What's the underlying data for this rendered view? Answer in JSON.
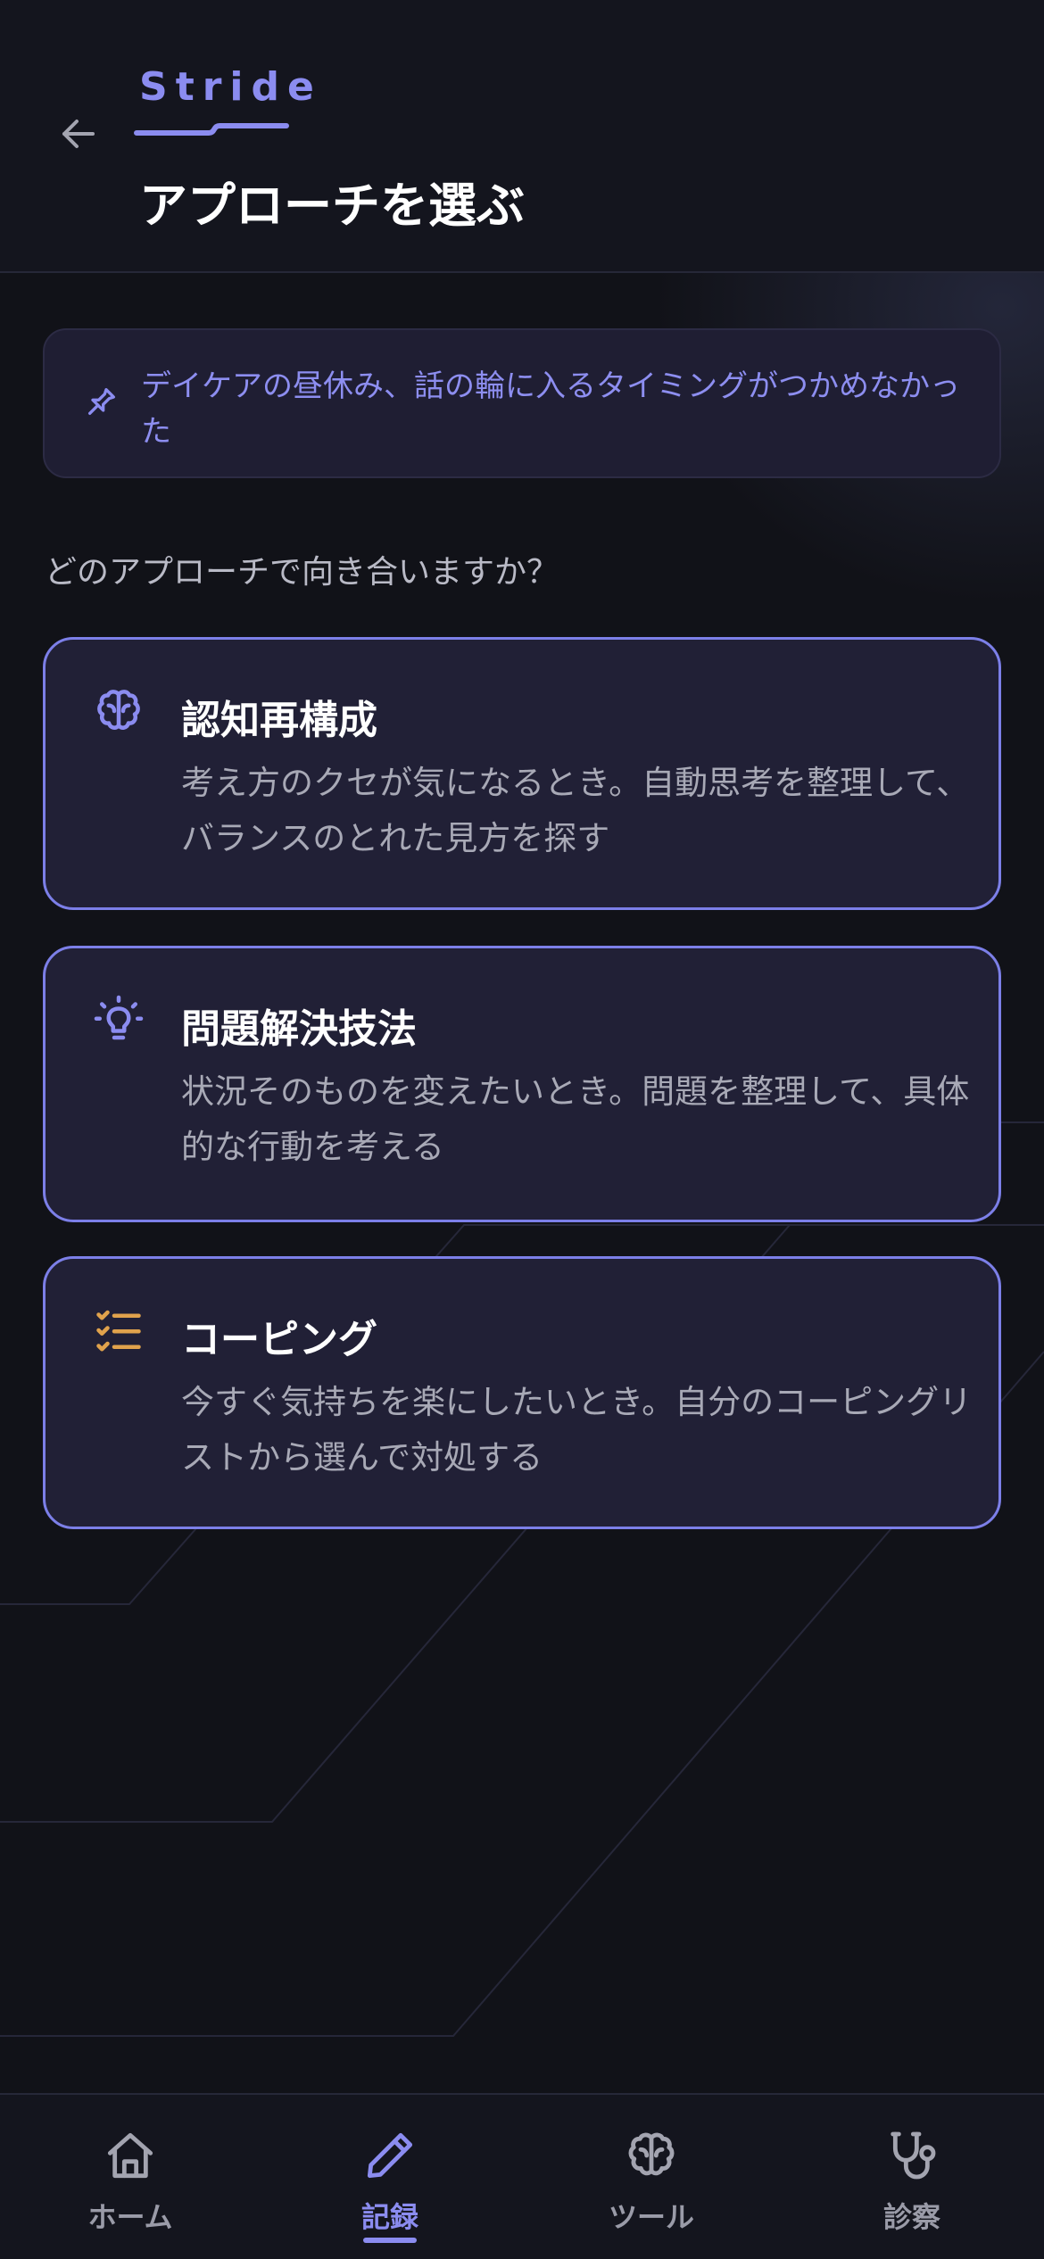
{
  "header": {
    "brand": "Stride",
    "title": "アプローチを選ぶ"
  },
  "note": {
    "text": "デイケアの昼休み、話の輪に入るタイミングがつかめなかった"
  },
  "prompt": "どのアプローチで向き合いますか？",
  "approaches": [
    {
      "icon": "brain-icon",
      "title": "認知再構成",
      "description": "考え方のクセが気になるとき。自動思考を整理して、バランスのとれた見方を探す"
    },
    {
      "icon": "lightbulb-icon",
      "title": "問題解決技法",
      "description": "状況そのものを変えたいとき。問題を整理して、具体的な行動を考える"
    },
    {
      "icon": "checklist-icon",
      "title": "コーピング",
      "description": "今すぐ気持ちを楽にしたいとき。自分のコーピングリストから選んで対処する"
    }
  ],
  "nav": {
    "items": [
      {
        "label": "ホーム",
        "icon": "home-icon",
        "active": false
      },
      {
        "label": "記録",
        "icon": "pencil-icon",
        "active": true
      },
      {
        "label": "ツール",
        "icon": "brain-icon",
        "active": false
      },
      {
        "label": "診察",
        "icon": "stethoscope-icon",
        "active": false
      }
    ]
  },
  "colors": {
    "background": "#111218",
    "accent": "#8b8cf0",
    "card_border": "#7c7fe8",
    "card_bg": "#212036",
    "coping_icon": "#e0a24c"
  }
}
